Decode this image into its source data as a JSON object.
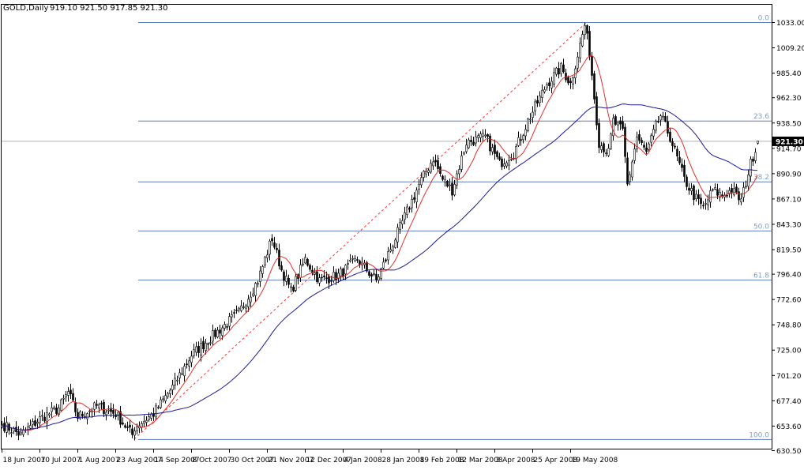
{
  "header": {
    "symbol_label": "GOLD,Daily",
    "ohlc_text": "919.10 921.50 917.85 921.30"
  },
  "price_tag": "921.30",
  "colors": {
    "bull_body": "#ffffff",
    "bear_body": "#000000",
    "candle_outline": "#000000",
    "ma_fast": "#e0302a",
    "ma_slow": "#1a1a9a",
    "fib_line": "#5d7fb6",
    "fib_label": "#7ea0c8",
    "trend_line": "#ff3333",
    "axis": "#000000",
    "price_line": "#b0b0b0",
    "tag_bg": "#000000",
    "tag_text": "#ffffff"
  },
  "chart_data": {
    "type": "candlestick",
    "title": "GOLD,Daily",
    "ylim": [
      630.5,
      1045
    ],
    "y_ticks": [
      "1033.00",
      "1009.20",
      "985.40",
      "962.30",
      "938.50",
      "914.70",
      "890.90",
      "867.10",
      "843.30",
      "819.50",
      "796.40",
      "772.60",
      "748.80",
      "725.00",
      "701.20",
      "677.40",
      "653.60",
      "630.50"
    ],
    "x_tick_labels": [
      "18 Jun 2007",
      "10 Jul 2007",
      "1 Aug 2007",
      "23 Aug 2007",
      "14 Sep 2007",
      "8 Oct 2007",
      "30 Oct 2007",
      "21 Nov 2007",
      "12 Dec 2007",
      "4 Jan 2008",
      "28 Jan 2008",
      "19 Feb 2008",
      "12 Mar 2008",
      "3 Apr 2008",
      "25 Apr 2008",
      "19 May 2008"
    ],
    "bars_per_label": 16,
    "close_anchors": [
      [
        0,
        655
      ],
      [
        8,
        645
      ],
      [
        16,
        660
      ],
      [
        24,
        670
      ],
      [
        28,
        685
      ],
      [
        32,
        662
      ],
      [
        40,
        672
      ],
      [
        48,
        665
      ],
      [
        55,
        645
      ],
      [
        56,
        652
      ],
      [
        64,
        665
      ],
      [
        72,
        690
      ],
      [
        80,
        720
      ],
      [
        90,
        740
      ],
      [
        100,
        760
      ],
      [
        108,
        790
      ],
      [
        114,
        830
      ],
      [
        118,
        800
      ],
      [
        122,
        780
      ],
      [
        128,
        810
      ],
      [
        134,
        790
      ],
      [
        142,
        795
      ],
      [
        150,
        810
      ],
      [
        158,
        790
      ],
      [
        164,
        820
      ],
      [
        170,
        850
      ],
      [
        176,
        880
      ],
      [
        182,
        905
      ],
      [
        186,
        885
      ],
      [
        190,
        875
      ],
      [
        196,
        920
      ],
      [
        204,
        925
      ],
      [
        210,
        900
      ],
      [
        216,
        910
      ],
      [
        222,
        940
      ],
      [
        230,
        975
      ],
      [
        236,
        990
      ],
      [
        240,
        975
      ],
      [
        246,
        1030
      ],
      [
        248,
        1005
      ],
      [
        252,
        920
      ],
      [
        256,
        910
      ],
      [
        258,
        940
      ],
      [
        262,
        930
      ],
      [
        264,
        880
      ],
      [
        268,
        925
      ],
      [
        272,
        910
      ],
      [
        276,
        935
      ],
      [
        278,
        945
      ],
      [
        282,
        925
      ],
      [
        288,
        885
      ],
      [
        292,
        870
      ],
      [
        296,
        858
      ],
      [
        300,
        875
      ],
      [
        304,
        870
      ],
      [
        308,
        875
      ],
      [
        312,
        865
      ],
      [
        316,
        900
      ],
      [
        319,
        921.3
      ]
    ],
    "fib_levels": [
      {
        "label": "0.0",
        "value": 1033.0
      },
      {
        "label": "23.6",
        "value": 940.4
      },
      {
        "label": "38.2",
        "value": 883.2
      },
      {
        "label": "50.0",
        "value": 837.0
      },
      {
        "label": "61.8",
        "value": 790.8
      },
      {
        "label": "100.0",
        "value": 641.0
      }
    ],
    "trend_line": {
      "from": [
        56,
        641.0
      ],
      "to": [
        247,
        1033.0
      ]
    },
    "last_price": 921.3,
    "moving_averages": [
      {
        "kind": "fast",
        "period": 10
      },
      {
        "kind": "slow",
        "period": 50
      }
    ],
    "grid": false
  }
}
